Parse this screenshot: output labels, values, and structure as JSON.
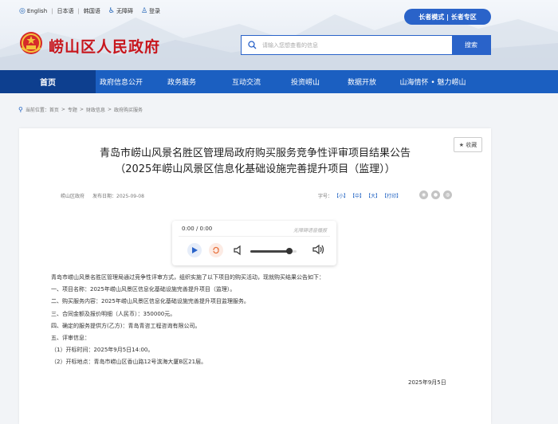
{
  "topbar": {
    "english": "English",
    "japanese": "日本语",
    "korean": "韩国语",
    "accessible": "无障碍",
    "login": "登录"
  },
  "elder_mode": "长者模式 | 长者专区",
  "site": {
    "title": "崂山区人民政府"
  },
  "search": {
    "placeholder": "请输入您想查看的信息",
    "button": "搜索"
  },
  "nav": [
    "首页",
    "政府信息公开",
    "政务服务",
    "互动交流",
    "投资崂山",
    "数据开放",
    "山海情怀 • 魅力崂山"
  ],
  "breadcrumb": {
    "prefix": "当前位置：",
    "items": [
      "首页",
      "专题",
      "财政信息",
      "政府购买服务"
    ]
  },
  "article": {
    "favorite": "★ 收藏",
    "title_line1": "青岛市崂山风景名胜区管理局政府购买服务竞争性评审项目结果公告",
    "title_line2": "（2025年崂山风景区信息化基础设施完善提升项目（监理））",
    "source": "崂山区政府",
    "publish": "发布日期：2025-09-08",
    "fontsize_label": "字号：",
    "fontsize_small": "【小】",
    "fontsize_medium": "【中】",
    "fontsize_large": "【大】",
    "print": "【打印】",
    "player": {
      "time": "0:00 / 0:00",
      "tts_label": "无障碍语音播报",
      "volume_level": 0.85
    },
    "paragraphs": [
      "青岛市崂山风景名胜区管理局通过竞争性评审方式，组织实施了以下项目的购买活动，现就购买结果公告如下：",
      "一、项目名称：2025年崂山风景区信息化基础设施完善提升项目（监理）。",
      "二、购买服务内容：2025年崂山风景区信息化基础设施完善提升项目监理服务。",
      "三、合同金额及报价明细（人民币）：350000元。",
      "四、确定的服务提供方(乙方)：青岛青咨工程咨询有限公司。",
      "五、评审信息：",
      "（1）开标时间：2025年9月5日14:00。",
      "（2）开标地点：青岛市崂山区香山路12号滨海大厦B区21层。"
    ],
    "date_sign": "2025年9月5日"
  },
  "colors": {
    "brand_red": "#c8161d",
    "nav_blue": "#1b5fc1",
    "nav_active": "#0d3f8f"
  }
}
